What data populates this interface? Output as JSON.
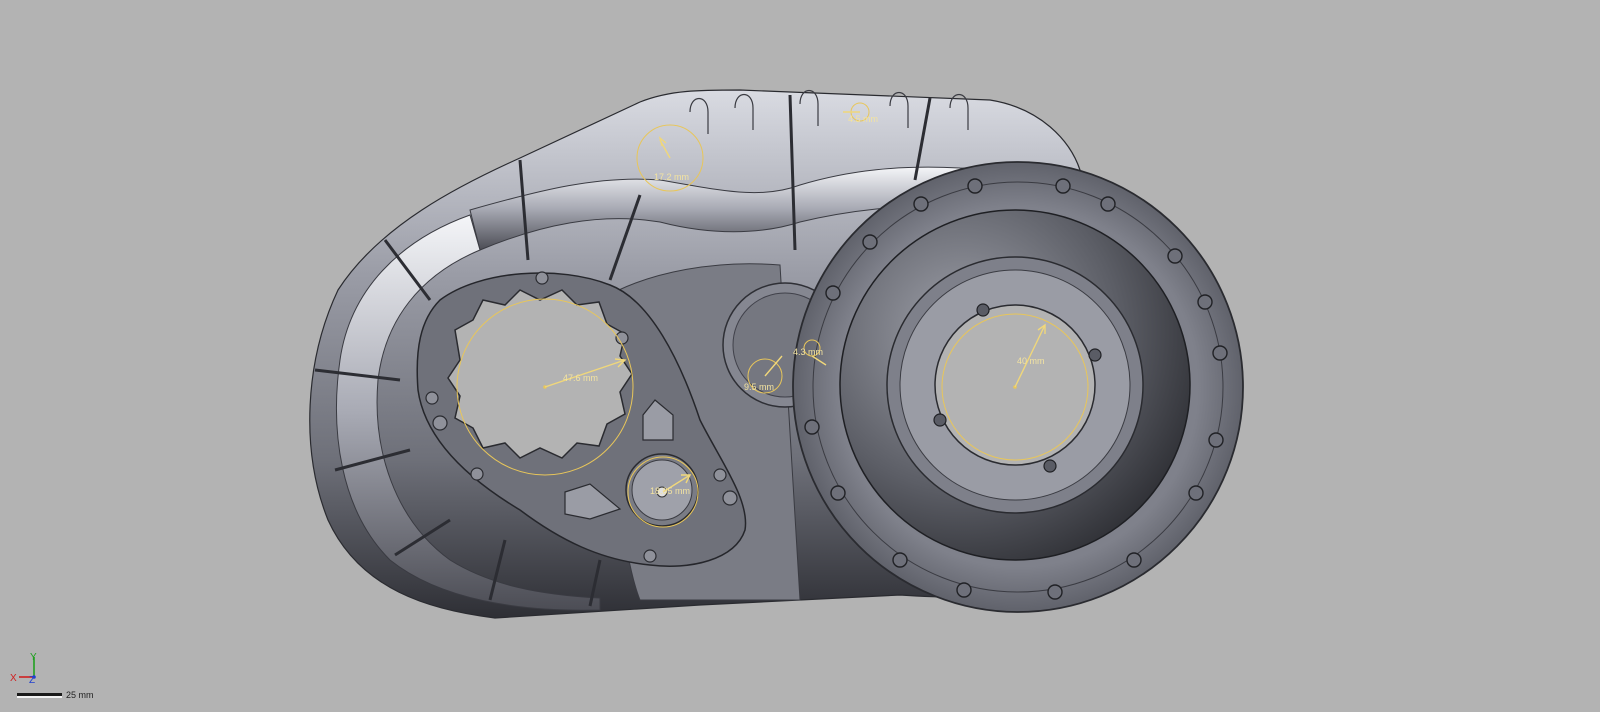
{
  "viewport": {
    "background": "#b3b3b3",
    "model_color": "#8a8c96",
    "dimension_color": "#e8c65a"
  },
  "dimensions": [
    {
      "id": "dim-17-2",
      "label": "17.2 mm"
    },
    {
      "id": "dim-4-5",
      "label": "4.5 mm"
    },
    {
      "id": "dim-47-6",
      "label": "47.6 mm"
    },
    {
      "id": "dim-18-05",
      "label": "18.05 mm"
    },
    {
      "id": "dim-9-5",
      "label": "9.5 mm"
    },
    {
      "id": "dim-4-3",
      "label": "4.3 mm"
    },
    {
      "id": "dim-40",
      "label": "40 mm"
    }
  ],
  "triad": {
    "x_label": "X",
    "y_label": "Y",
    "z_label": "Z",
    "x_color": "#d02020",
    "y_color": "#20a020",
    "z_color": "#2040d0"
  },
  "scale_bar": {
    "label": "25 mm"
  }
}
